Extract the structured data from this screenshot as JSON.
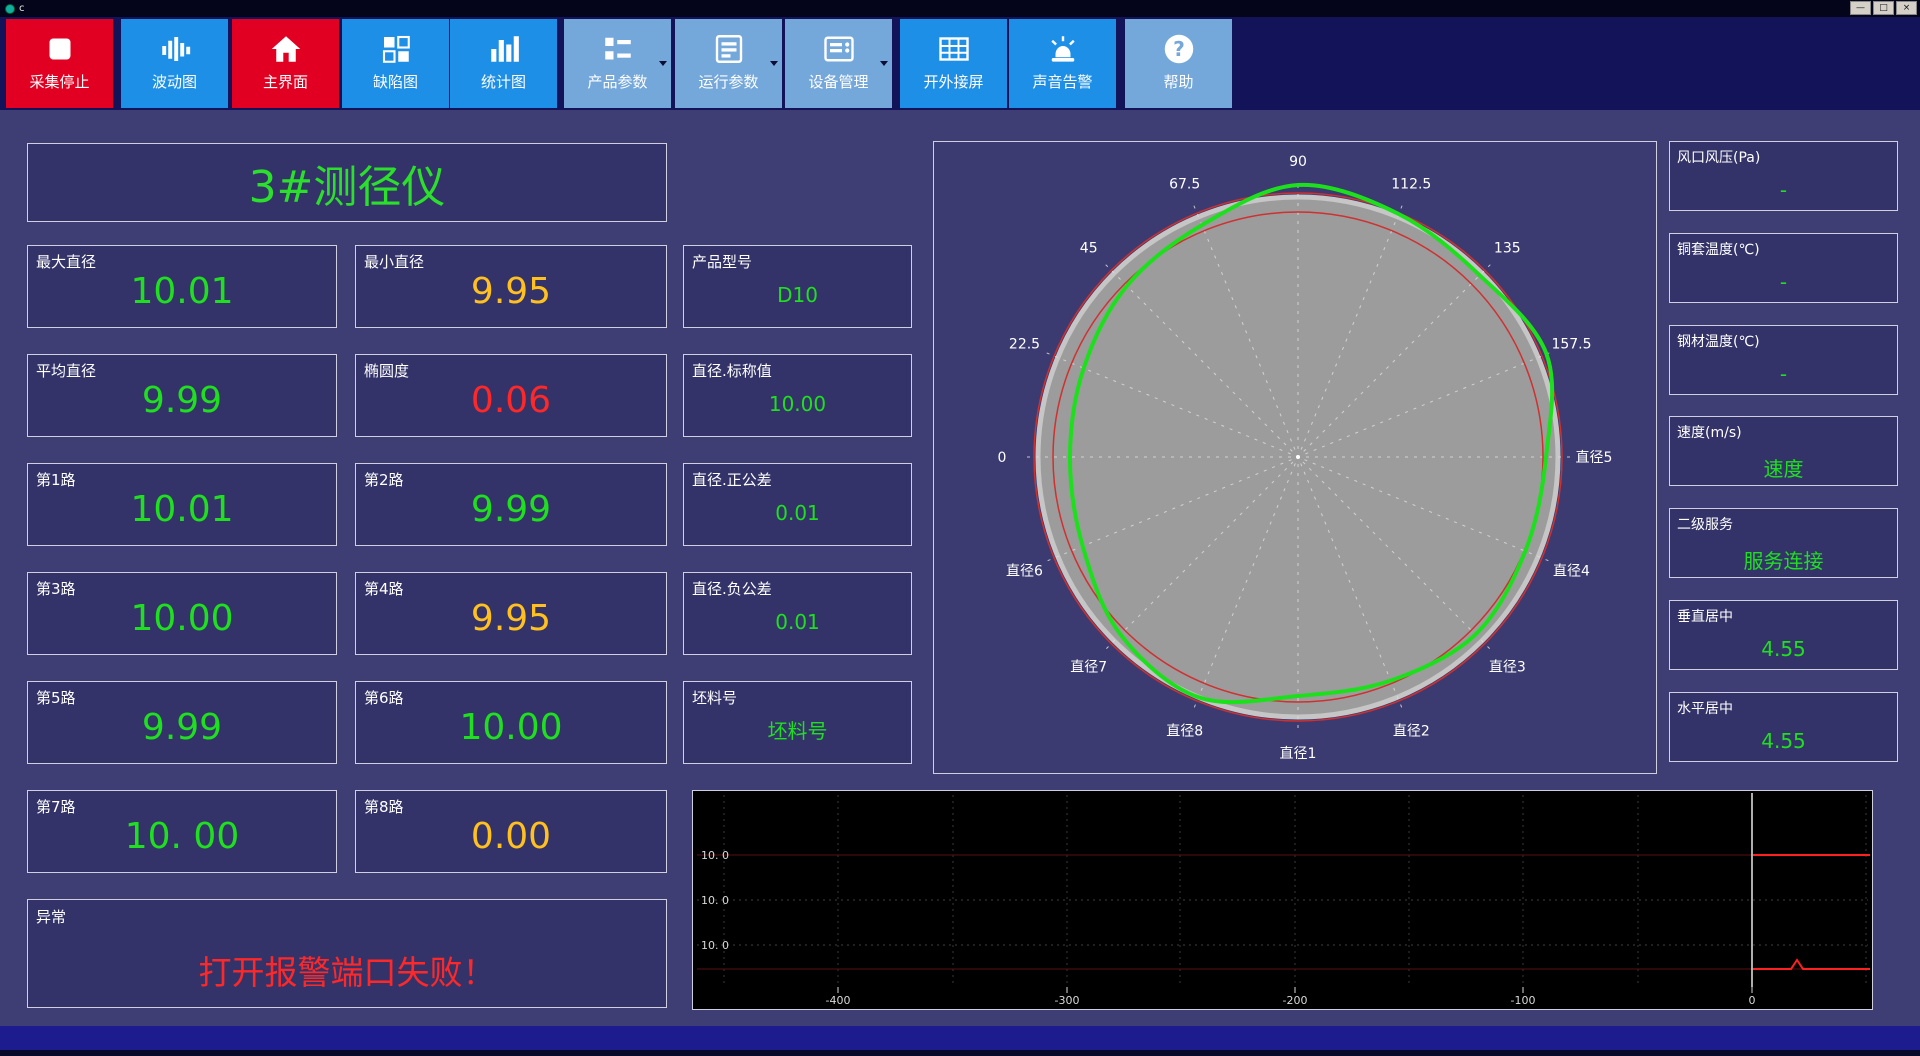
{
  "window": {
    "title": "c",
    "controls": [
      {
        "name": "minimize",
        "glyph": "—"
      },
      {
        "name": "maximize",
        "glyph": "□"
      },
      {
        "name": "close",
        "glyph": "×"
      }
    ]
  },
  "toolbar": {
    "buttons": [
      {
        "id": "stop-collect",
        "label": "采集停止",
        "color": "red",
        "icon": "stop-icon",
        "dropdown": false
      },
      {
        "id": "wave-chart",
        "label": "波动图",
        "color": "blue",
        "icon": "wave-icon",
        "dropdown": false
      },
      {
        "id": "main-screen",
        "label": "主界面",
        "color": "red",
        "icon": "home-icon",
        "dropdown": false
      },
      {
        "id": "defect-chart",
        "label": "缺陷图",
        "color": "blue",
        "icon": "defect-grid-icon",
        "dropdown": false
      },
      {
        "id": "stats-chart",
        "label": "统计图",
        "color": "blue",
        "icon": "bar-chart-icon",
        "dropdown": false
      },
      {
        "id": "product-params",
        "label": "产品参数",
        "color": "light",
        "icon": "product-params-icon",
        "dropdown": true
      },
      {
        "id": "run-params",
        "label": "运行参数",
        "color": "light",
        "icon": "run-params-icon",
        "dropdown": true
      },
      {
        "id": "device-mgmt",
        "label": "设备管理",
        "color": "light",
        "icon": "device-panel-icon",
        "dropdown": true
      },
      {
        "id": "ext-screen",
        "label": "开外接屏",
        "color": "blue",
        "icon": "external-screen-icon",
        "dropdown": false
      },
      {
        "id": "sound-alarm",
        "label": "声音告警",
        "color": "blue",
        "icon": "siren-icon",
        "dropdown": false
      },
      {
        "id": "help",
        "label": "帮助",
        "color": "light",
        "icon": "help-icon",
        "dropdown": false
      }
    ]
  },
  "main": {
    "title": "3#测径仪",
    "metrics": [
      {
        "row": 1,
        "col": 1,
        "label": "最大直径",
        "value": "10.01",
        "color": "green",
        "size": "big"
      },
      {
        "row": 1,
        "col": 2,
        "label": "最小直径",
        "value": "9.95",
        "color": "yellow",
        "size": "big"
      },
      {
        "row": 1,
        "col": 3,
        "label": "产品型号",
        "value": "D10",
        "color": "green",
        "size": "small"
      },
      {
        "row": 2,
        "col": 1,
        "label": "平均直径",
        "value": "9.99",
        "color": "green",
        "size": "big"
      },
      {
        "row": 2,
        "col": 2,
        "label": "椭圆度",
        "value": "0.06",
        "color": "red",
        "size": "big"
      },
      {
        "row": 2,
        "col": 3,
        "label": "直径.标称值",
        "value": "10.00",
        "color": "green",
        "size": "small"
      },
      {
        "row": 3,
        "col": 1,
        "label": "第1路",
        "value": "10.01",
        "color": "green",
        "size": "big"
      },
      {
        "row": 3,
        "col": 2,
        "label": "第2路",
        "value": "9.99",
        "color": "green",
        "size": "big"
      },
      {
        "row": 3,
        "col": 3,
        "label": "直径.正公差",
        "value": "0.01",
        "color": "green",
        "size": "small"
      },
      {
        "row": 4,
        "col": 1,
        "label": "第3路",
        "value": "10.00",
        "color": "green",
        "size": "big"
      },
      {
        "row": 4,
        "col": 2,
        "label": "第4路",
        "value": "9.95",
        "color": "yellow",
        "size": "big"
      },
      {
        "row": 4,
        "col": 3,
        "label": "直径.负公差",
        "value": "0.01",
        "color": "green",
        "size": "small"
      },
      {
        "row": 5,
        "col": 1,
        "label": "第5路",
        "value": "9.99",
        "color": "green",
        "size": "big"
      },
      {
        "row": 5,
        "col": 2,
        "label": "第6路",
        "value": "10.00",
        "color": "green",
        "size": "big"
      },
      {
        "row": 5,
        "col": 3,
        "label": "坯料号",
        "value": "坯料号",
        "color": "green",
        "size": "small"
      },
      {
        "row": 6,
        "col": 1,
        "label": "第7路",
        "value": "10. 00",
        "color": "green",
        "size": "big"
      },
      {
        "row": 6,
        "col": 2,
        "label": "第8路",
        "value": "0.00",
        "color": "yellow",
        "size": "big"
      }
    ],
    "alarm": {
      "label": "异常",
      "message": "打开报警端口失败！"
    }
  },
  "polar_chart": {
    "labels": [
      {
        "text": "0",
        "angle": 180
      },
      {
        "text": "22.5",
        "angle": 157.5
      },
      {
        "text": "45",
        "angle": 135
      },
      {
        "text": "67.5",
        "angle": 112.5
      },
      {
        "text": "90",
        "angle": 90
      },
      {
        "text": "112.5",
        "angle": 67.5
      },
      {
        "text": "135",
        "angle": 45
      },
      {
        "text": "157.5",
        "angle": 22.5
      },
      {
        "text": "直径5",
        "angle": 0
      },
      {
        "text": "直径4",
        "angle": 337.5
      },
      {
        "text": "直径3",
        "angle": 315
      },
      {
        "text": "直径2",
        "angle": 292.5
      },
      {
        "text": "直径1",
        "angle": 270
      },
      {
        "text": "直径8",
        "angle": 247.5
      },
      {
        "text": "直径7",
        "angle": 225
      },
      {
        "text": "直径6",
        "angle": 202.5
      }
    ],
    "profile_radii": [
      248,
      269,
      257,
      263,
      272,
      251,
      242,
      232,
      228,
      233,
      251,
      260,
      239,
      242,
      251,
      246
    ],
    "nominal_radius": 260,
    "tolerance_radii": [
      245,
      264
    ],
    "profile_color": "#1de01d",
    "tolerance_color": "#cf3030"
  },
  "right_panel": {
    "items": [
      {
        "label": "风口风压(Pa)",
        "value": "-",
        "color": "green"
      },
      {
        "label": "铜套温度(℃)",
        "value": "-",
        "color": "green"
      },
      {
        "label": "钢材温度(℃)",
        "value": "-",
        "color": "green"
      },
      {
        "label": "速度(m/s)",
        "value": "速度",
        "color": "green"
      },
      {
        "label": "二级服务",
        "value": "服务连接",
        "color": "green"
      },
      {
        "label": "垂直居中",
        "value": "4.55",
        "color": "green"
      },
      {
        "label": "水平居中",
        "value": "4.55",
        "color": "green"
      }
    ]
  },
  "bottom_chart": {
    "y_axis_labels": [
      "10. 0",
      "10. 0",
      "10. 0"
    ],
    "x_axis_labels": [
      "-400",
      "-300",
      "-200",
      "-100",
      "0"
    ],
    "line_color": "#ff2020"
  }
}
